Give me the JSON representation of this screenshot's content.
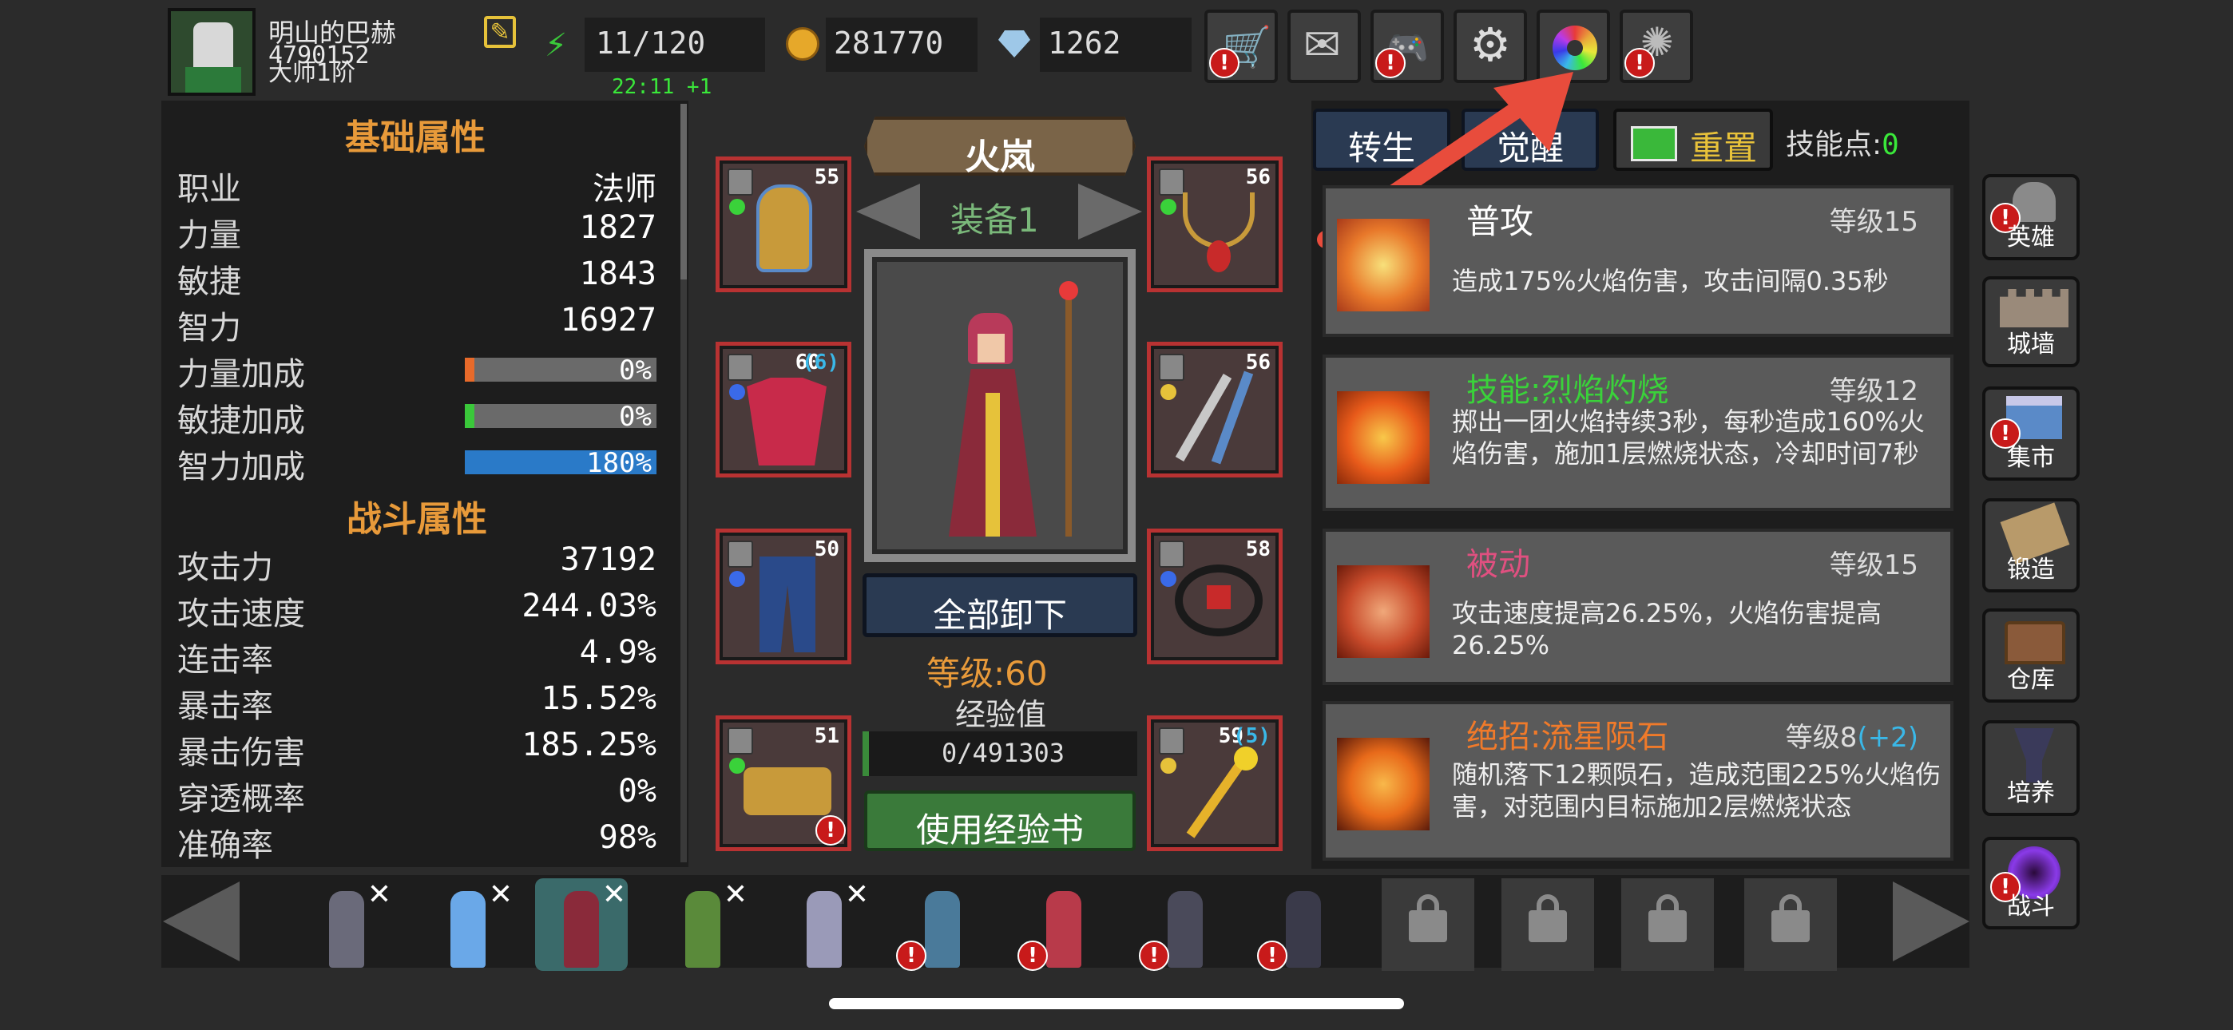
{
  "player": {
    "name": "明山的巴赫",
    "id": "4790152",
    "title": "大师1阶"
  },
  "resources": {
    "energy": "11/120",
    "timer": "22:11 +1",
    "gold": "281770",
    "diamond": "1262"
  },
  "top_icons": [
    "shop-cart-icon",
    "mail-icon",
    "gamepad-icon",
    "gear-icon",
    "color-wheel-icon",
    "fireworks-icon"
  ],
  "stats": {
    "basic_title": "基础属性",
    "class_label": "职业",
    "class_value": "法师",
    "str_label": "力量",
    "str_value": "1827",
    "agi_label": "敏捷",
    "agi_value": "1843",
    "int_label": "智力",
    "int_value": "16927",
    "str_bonus_label": "力量加成",
    "str_bonus": "0%",
    "str_bonus_fill": 0,
    "agi_bonus_label": "敏捷加成",
    "agi_bonus": "0%",
    "agi_bonus_fill": 0,
    "int_bonus_label": "智力加成",
    "int_bonus": "180%",
    "int_bonus_fill": 1,
    "combat_title": "战斗属性",
    "atk_label": "攻击力",
    "atk": "37192",
    "aspd_label": "攻击速度",
    "aspd": "244.03%",
    "combo_label": "连击率",
    "combo": "4.9%",
    "crit_label": "暴击率",
    "crit": "15.52%",
    "critdmg_label": "暴击伤害",
    "critdmg": "185.25%",
    "pierce_label": "穿透概率",
    "pierce": "0%",
    "acc_label": "准确率",
    "acc": "98%"
  },
  "hero": {
    "name": "火岚",
    "set": "装备1",
    "unequip": "全部卸下",
    "level_label": "等级:60",
    "exp_label": "经验值",
    "exp": "0/491303",
    "use_exp_book": "使用经验书"
  },
  "slots": {
    "l1": "55",
    "l2": "60",
    "l2b": "(6)",
    "l3": "50",
    "l4": "51",
    "r1": "56",
    "r2": "56",
    "r3": "58",
    "r4": "59",
    "r4b": "(5)"
  },
  "tabs": {
    "rebirth": "转生",
    "awaken": "觉醒",
    "reset": "重置",
    "skill_points_label": "技能点:",
    "skill_points": "0"
  },
  "skills": [
    {
      "name": "普攻",
      "level": "等级15",
      "desc": "造成175%火焰伤害，攻击间隔0.35秒"
    },
    {
      "name": "技能:烈焰灼烧",
      "level": "等级12",
      "desc": "掷出一团火焰持续3秒，每秒造成160%火焰伤害，施加1层燃烧状态，冷却时间7秒"
    },
    {
      "name": "被动",
      "level": "等级15",
      "desc": "攻击速度提高26.25%，火焰伤害提高26.25%"
    },
    {
      "name": "绝招:流星陨石",
      "level": "等级8",
      "level_bonus": "(+2)",
      "desc": "随机落下12颗陨石，造成范围225%火焰伤害，对范围内目标施加2层燃烧状态"
    }
  ],
  "side_menu": [
    "英雄",
    "城墙",
    "集市",
    "锻造",
    "仓库",
    "培养",
    "战斗"
  ],
  "colors": {
    "accent_orange": "#e89a3a",
    "highlight_yellow": "#e6e63a",
    "skill_green": "#3ad23a",
    "passive_pink": "#e05080",
    "ultimate_orange": "#f07a2a",
    "bonus_blue": "#3ab8e8",
    "arrow_red": "#e84c3c"
  }
}
